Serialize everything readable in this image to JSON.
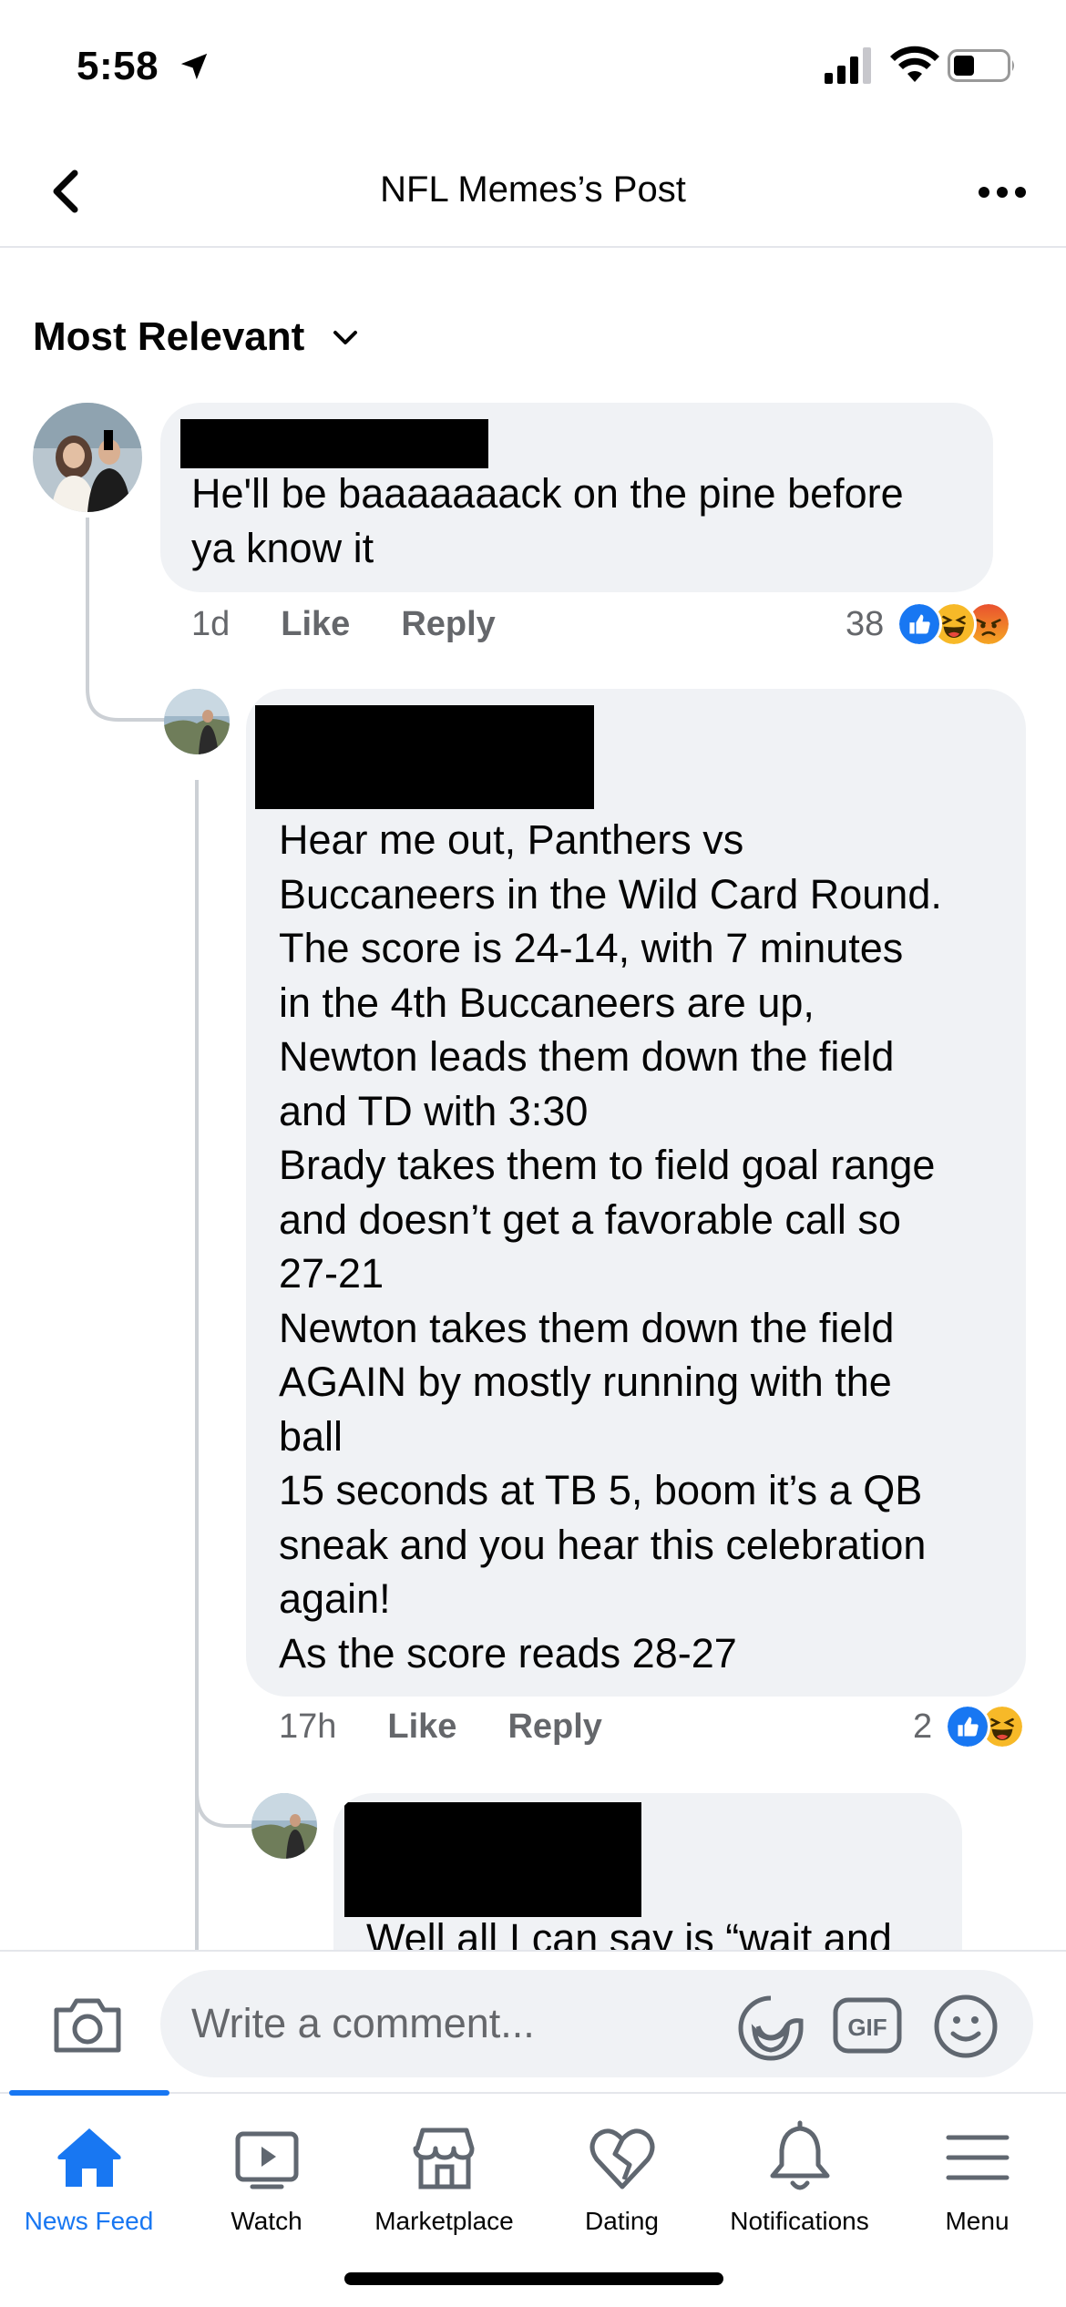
{
  "status_bar": {
    "time": "5:58"
  },
  "header": {
    "title": "NFL Memes’s Post"
  },
  "sort": {
    "label": "Most Relevant"
  },
  "comments": [
    {
      "text": "He'll be baaaaaaack on the pine before\nya know it",
      "time": "1d",
      "like_label": "Like",
      "reply_label": "Reply",
      "reaction_count": "38",
      "reactions": [
        "like-icon",
        "haha-icon",
        "angry-icon"
      ]
    },
    {
      "text": "Hear me out, Panthers vs\nBuccaneers in the Wild Card Round.\nThe score is 24-14, with 7 minutes\nin the 4th Buccaneers are up,\nNewton leads them down the field\nand TD with 3:30\nBrady takes them to field goal range\nand doesn’t get a favorable call so\n27-21\nNewton takes them down the field\nAGAIN by mostly running with the\nball\n15 seconds at TB 5, boom it’s a QB\nsneak and you hear this celebration\nagain!\nAs the score reads 28-27",
      "time": "17h",
      "like_label": "Like",
      "reply_label": "Reply",
      "reaction_count": "2",
      "reactions": [
        "like-icon",
        "haha-icon"
      ]
    },
    {
      "text": "Well all I can say is “wait and"
    }
  ],
  "composer": {
    "placeholder": "Write a comment..."
  },
  "tabs": [
    {
      "label": "News Feed",
      "icon": "home-icon",
      "active": true
    },
    {
      "label": "Watch",
      "icon": "watch-icon",
      "active": false
    },
    {
      "label": "Marketplace",
      "icon": "marketplace-icon",
      "active": false
    },
    {
      "label": "Dating",
      "icon": "dating-icon",
      "active": false
    },
    {
      "label": "Notifications",
      "icon": "bell-icon",
      "active": false
    },
    {
      "label": "Menu",
      "icon": "menu-icon",
      "active": false
    }
  ],
  "colors": {
    "accent": "#1877f2",
    "bubble": "#f0f2f5",
    "secondary_text": "#65676b"
  }
}
